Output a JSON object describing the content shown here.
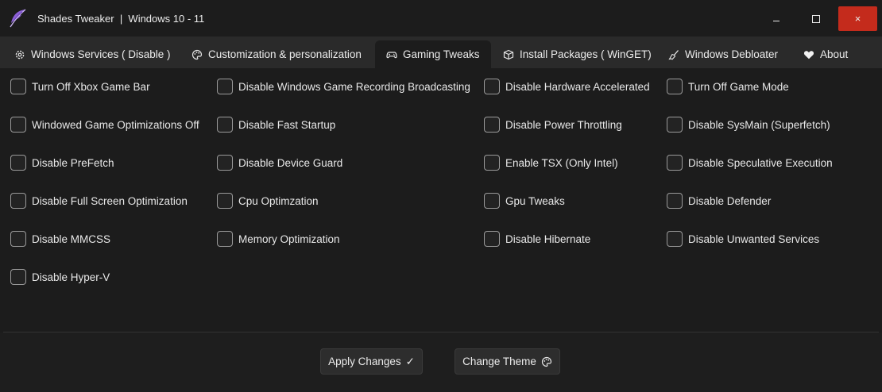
{
  "window": {
    "title": "Shades Tweaker  |  Windows 10 - 11",
    "icon": "feather-icon",
    "close_glyph": "×",
    "colors": {
      "close": "#c42b1c",
      "background": "#1c1c1c",
      "tabbar": "#2a2a2a"
    }
  },
  "tabs": [
    {
      "label": "Windows Services ( Disable )",
      "icon": "gear-icon"
    },
    {
      "label": "Customization & personalization",
      "icon": "palette-icon"
    },
    {
      "label": "Gaming Tweaks",
      "icon": "gamepad-icon",
      "active": true
    },
    {
      "label": "Install Packages ( WinGET)",
      "icon": "package-icon"
    },
    {
      "label": "Windows Debloater",
      "icon": "broom-icon"
    },
    {
      "label": "About",
      "icon": "heart-icon"
    }
  ],
  "options": {
    "col1": [
      "Turn Off Xbox Game Bar",
      "Windowed Game Optimizations Off",
      "Disable PreFetch",
      "Disable Full Screen Optimization",
      "Disable MMCSS",
      "Disable Hyper-V"
    ],
    "col2": [
      "Disable Windows Game Recording Broadcasting",
      "Disable Fast Startup",
      "Disable Device Guard",
      "Cpu Optimzation",
      "Memory Optimization"
    ],
    "col3": [
      "Disable Hardware Accelerated",
      "Disable Power Throttling",
      "Enable TSX (Only Intel)",
      "Gpu Tweaks",
      "Disable Hibernate"
    ],
    "col4": [
      "Turn Off Game Mode",
      "Disable SysMain (Superfetch)",
      "Disable Speculative Execution",
      "Disable Defender",
      "Disable Unwanted Services"
    ]
  },
  "footer": {
    "apply_label": "Apply Changes",
    "apply_icon": "✓",
    "theme_label": "Change Theme",
    "theme_icon": "palette-icon"
  }
}
